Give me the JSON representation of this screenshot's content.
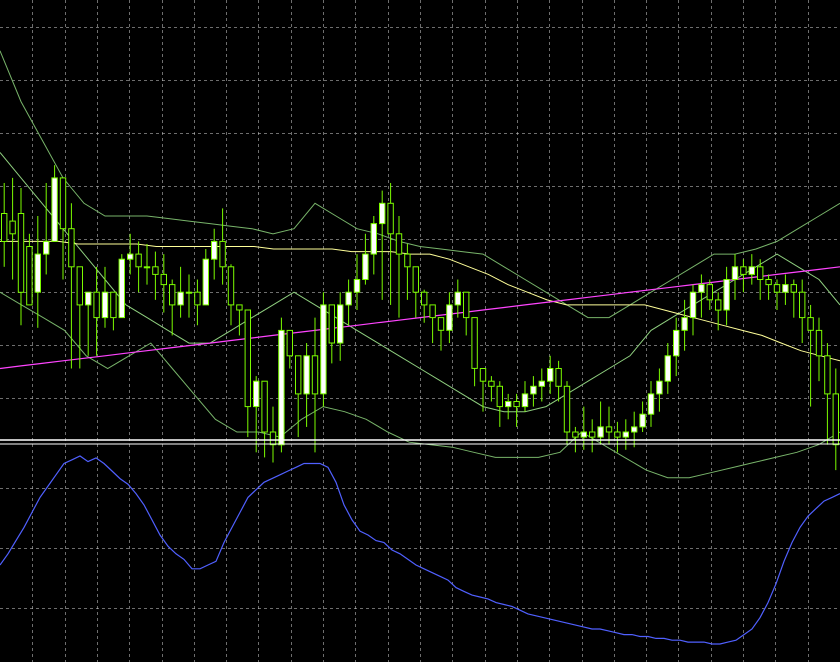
{
  "colors": {
    "background": "#000000",
    "grid": "#c8c8c8",
    "candle_up_body": "#ffffff",
    "candle_down_body": "#000000",
    "candle_outline": "#7cfc00",
    "ma_long": "#ffff99",
    "ma_very_long": "#ff44ff",
    "band_outer": "#78b46a",
    "band_inner": "#8fcf7f",
    "ma_short": "#b8ffb8",
    "oscillator": "#5060ff",
    "separator": "#ffffff"
  },
  "chart_data": [
    {
      "type": "candlestick",
      "title": "",
      "grid": true,
      "ylim": [
        -70,
        100
      ],
      "candles": [
        [
          16,
          5,
          -5,
          28,
          -5
        ],
        [
          13,
          8,
          -10,
          30,
          -8
        ],
        [
          16,
          -15,
          -25,
          26,
          -28
        ],
        [
          3,
          -20,
          -15,
          8,
          -20
        ],
        [
          -15,
          0,
          -27,
          15,
          -29
        ],
        [
          0,
          5,
          -5,
          28,
          -8
        ],
        [
          5,
          30,
          10,
          35,
          8
        ],
        [
          30,
          10,
          -10,
          28,
          -8
        ],
        [
          10,
          -5,
          -15,
          20,
          -45
        ],
        [
          -5,
          -20,
          -28,
          -5,
          -45
        ],
        [
          -20,
          -15,
          -25,
          -15,
          -40
        ],
        [
          -15,
          -25,
          -35,
          -5,
          -40
        ],
        [
          -25,
          -15,
          -27,
          -5,
          -29
        ],
        [
          -15,
          -25,
          -28,
          -15,
          -30
        ],
        [
          -25,
          -2,
          -10,
          0,
          -15
        ],
        [
          -2,
          0,
          -5,
          8,
          -8
        ],
        [
          0,
          -5,
          -12,
          5,
          -15
        ],
        [
          -5,
          -5,
          -10,
          4,
          -12
        ],
        [
          -5,
          -8,
          -12,
          1,
          -18
        ],
        [
          -8,
          -12,
          -22,
          0,
          -23
        ],
        [
          -12,
          -20,
          -30,
          -10,
          -32
        ],
        [
          -20,
          -15,
          -25,
          -5,
          -25
        ],
        [
          -15,
          -15,
          -20,
          -8,
          -25
        ],
        [
          -15,
          -20,
          -25,
          -10,
          -28
        ],
        [
          -20,
          -2,
          -15,
          2,
          -20
        ],
        [
          -2,
          5,
          -8,
          10,
          -10
        ],
        [
          5,
          -5,
          -10,
          18,
          -12
        ],
        [
          -5,
          -20,
          -28,
          -4,
          -28
        ],
        [
          -20,
          -22,
          -30,
          -20,
          -32
        ],
        [
          -22,
          -60,
          -70,
          -25,
          -72
        ],
        [
          -60,
          -50,
          -75,
          -48,
          -78
        ],
        [
          -50,
          -70,
          -78,
          -50,
          -80
        ],
        [
          -70,
          -75,
          -80,
          -60,
          -82
        ],
        [
          -75,
          -30,
          -75,
          -25,
          -78
        ],
        [
          -30,
          -40,
          -42,
          -30,
          -45
        ],
        [
          -40,
          -55,
          -70,
          -40,
          -72
        ],
        [
          -55,
          -40,
          -65,
          -35,
          -68
        ],
        [
          -40,
          -55,
          -62,
          -25,
          -78
        ],
        [
          -55,
          -20,
          -58,
          -15,
          -60
        ],
        [
          -20,
          -35,
          -40,
          -20,
          -43
        ],
        [
          -35,
          -20,
          -40,
          -15,
          -42
        ],
        [
          -20,
          -15,
          -25,
          -10,
          -28
        ],
        [
          -15,
          -10,
          -20,
          0,
          -22
        ],
        [
          -10,
          0,
          -5,
          8,
          -12
        ],
        [
          0,
          12,
          -5,
          15,
          -8
        ],
        [
          12,
          20,
          -5,
          25,
          -18
        ],
        [
          20,
          8,
          5,
          28,
          -20
        ],
        [
          8,
          0,
          -5,
          15,
          -25
        ],
        [
          0,
          -5,
          -10,
          4,
          -18
        ],
        [
          -5,
          -15,
          -22,
          -10,
          -25
        ],
        [
          -15,
          -20,
          -22,
          -14,
          -27
        ],
        [
          -20,
          -25,
          -30,
          -20,
          -35
        ],
        [
          -25,
          -30,
          -35,
          -25,
          -38
        ],
        [
          -30,
          -20,
          -32,
          -15,
          -35
        ],
        [
          -20,
          -15,
          -22,
          -10,
          -25
        ],
        [
          -15,
          -25,
          -30,
          -18,
          -32
        ],
        [
          -25,
          -45,
          -50,
          -25,
          -52
        ],
        [
          -45,
          -50,
          -60,
          -45,
          -62
        ],
        [
          -50,
          -52,
          -56,
          -48,
          -58
        ],
        [
          -52,
          -60,
          -65,
          -50,
          -68
        ],
        [
          -60,
          -58,
          -62,
          -55,
          -65
        ],
        [
          -58,
          -60,
          -65,
          -55,
          -68
        ],
        [
          -60,
          -55,
          -60,
          -50,
          -62
        ],
        [
          -55,
          -52,
          -57,
          -48,
          -60
        ],
        [
          -52,
          -50,
          -55,
          -45,
          -58
        ],
        [
          -50,
          -45,
          -52,
          -40,
          -55
        ],
        [
          -45,
          -52,
          -55,
          -42,
          -58
        ],
        [
          -52,
          -70,
          -72,
          -50,
          -75
        ],
        [
          -70,
          -72,
          -75,
          -68,
          -78
        ],
        [
          -72,
          -70,
          -74,
          -60,
          -77
        ],
        [
          -70,
          -72,
          -75,
          -65,
          -78
        ],
        [
          -72,
          -68,
          -73,
          -58,
          -75
        ],
        [
          -68,
          -70,
          -72,
          -60,
          -75
        ],
        [
          -70,
          -72,
          -75,
          -66,
          -78
        ],
        [
          -72,
          -70,
          -74,
          -65,
          -77
        ],
        [
          -70,
          -68,
          -72,
          -62,
          -76
        ],
        [
          -68,
          -63,
          -68,
          -58,
          -70
        ],
        [
          -63,
          -55,
          -64,
          -50,
          -68
        ],
        [
          -55,
          -50,
          -60,
          -45,
          -62
        ],
        [
          -50,
          -40,
          -50,
          -35,
          -55
        ],
        [
          -40,
          -30,
          -45,
          -25,
          -48
        ],
        [
          -30,
          -25,
          -35,
          -18,
          -38
        ],
        [
          -25,
          -15,
          -30,
          -12,
          -32
        ],
        [
          -15,
          -12,
          -22,
          -8,
          -25
        ],
        [
          -12,
          -18,
          -20,
          -10,
          -22
        ],
        [
          -18,
          -22,
          -28,
          -15,
          -30
        ],
        [
          -22,
          -10,
          -25,
          -5,
          -28
        ],
        [
          -10,
          -5,
          -15,
          0,
          -18
        ],
        [
          -5,
          -8,
          -12,
          -2,
          -15
        ],
        [
          -8,
          -5,
          -10,
          0,
          -12
        ],
        [
          -5,
          -10,
          -15,
          -2,
          -18
        ],
        [
          -10,
          -12,
          -15,
          -8,
          -18
        ],
        [
          -12,
          -15,
          -20,
          -10,
          -22
        ],
        [
          -15,
          -12,
          -18,
          -8,
          -20
        ],
        [
          -12,
          -15,
          -22,
          -10,
          -25
        ],
        [
          -15,
          -25,
          -30,
          -10,
          -35
        ],
        [
          -25,
          -30,
          -40,
          -20,
          -60
        ],
        [
          -30,
          -40,
          -45,
          -25,
          -50
        ],
        [
          -40,
          -55,
          -60,
          -35,
          -75
        ],
        [
          -55,
          -75,
          -80,
          -45,
          -85
        ]
      ],
      "ma_long": [
        5,
        5,
        5,
        5,
        4,
        4,
        4,
        4,
        3,
        3,
        3,
        3,
        3,
        3,
        2,
        2,
        2,
        2,
        1,
        1,
        1,
        0,
        0,
        -2,
        -5,
        -8,
        -12,
        -15,
        -18,
        -20,
        -20,
        -20,
        -20,
        -20,
        -22,
        -24,
        -26,
        -28,
        -30,
        -32,
        -35,
        -38,
        -40,
        -42
      ],
      "ma_very_long": [
        -45,
        -44,
        -43,
        -42,
        -41,
        -40,
        -39,
        -38,
        -37,
        -36,
        -35,
        -34,
        -33,
        -32,
        -31,
        -30,
        -29,
        -28,
        -27,
        -26,
        -25,
        -24,
        -23,
        -22,
        -21,
        -20,
        -19,
        -18,
        -17,
        -16,
        -15,
        -14,
        -13,
        -12,
        -11,
        -10,
        -9,
        -8,
        -7,
        -6,
        -5
      ],
      "band_upper": [
        80,
        60,
        45,
        30,
        20,
        15,
        15,
        15,
        14,
        13,
        12,
        11,
        10,
        8,
        10,
        20,
        15,
        10,
        8,
        5,
        3,
        2,
        1,
        0,
        -5,
        -10,
        -15,
        -20,
        -25,
        -25,
        -20,
        -15,
        -10,
        -5,
        0,
        0,
        2,
        5,
        10,
        15,
        20
      ],
      "band_lower": [
        -15,
        -20,
        -25,
        -30,
        -40,
        -45,
        -40,
        -35,
        -45,
        -55,
        -65,
        -70,
        -70,
        -72,
        -65,
        -60,
        -62,
        -65,
        -70,
        -74,
        -75,
        -76,
        -78,
        -80,
        -80,
        -80,
        -78,
        -70,
        -75,
        -80,
        -85,
        -88,
        -88,
        -86,
        -84,
        -82,
        -80,
        -78,
        -75,
        -70
      ],
      "ma_short": [
        40,
        30,
        20,
        10,
        0,
        -10,
        -20,
        -25,
        -30,
        -35,
        -35,
        -30,
        -25,
        -20,
        -15,
        -20,
        -25,
        -30,
        -35,
        -40,
        -45,
        -50,
        -55,
        -60,
        -62,
        -62,
        -60,
        -55,
        -50,
        -45,
        -40,
        -30,
        -25,
        -20,
        -15,
        -10,
        -5,
        0,
        -5,
        -10,
        -20
      ]
    },
    {
      "type": "line",
      "title": "",
      "grid": true,
      "ylim": [
        0,
        100
      ],
      "series": [
        {
          "values": [
            42,
            48,
            55,
            62,
            70,
            78,
            84,
            90,
            96,
            98,
            100,
            97,
            99,
            96,
            92,
            88,
            85,
            80,
            74,
            66,
            58,
            52,
            48,
            45,
            40,
            40,
            42,
            44,
            54,
            62,
            70,
            78,
            82,
            86,
            88,
            90,
            92,
            94,
            96,
            96,
            96,
            94,
            86,
            74,
            66,
            60,
            58,
            55,
            54,
            50,
            48,
            45,
            42,
            40,
            38,
            36,
            34,
            30,
            28,
            26,
            25,
            24,
            22,
            21,
            20,
            18,
            16,
            15,
            14,
            13,
            12,
            11,
            10,
            9,
            8,
            8,
            7,
            6,
            5,
            5,
            4,
            4,
            3,
            3,
            2,
            2,
            1,
            1,
            1,
            0,
            0,
            1,
            2,
            5,
            8,
            14,
            22,
            32,
            44,
            54,
            62,
            68,
            72,
            76,
            78,
            80
          ]
        }
      ]
    }
  ]
}
